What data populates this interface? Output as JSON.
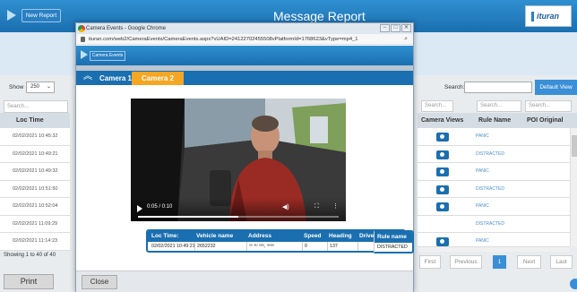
{
  "app": {
    "new_report_label": "New Report",
    "title": "Message Report",
    "logo_text": "ituran"
  },
  "table_controls": {
    "show_label": "Show",
    "show_value": "250",
    "search_label": "Search:",
    "default_view_label": "Default View",
    "column_search_placeholder": "Search..."
  },
  "left_table": {
    "header": "Loc Time",
    "rows": [
      "02/02/2021 10:45:32",
      "02/02/2021 10:49:21",
      "02/02/2021 10:49:32",
      "02/02/2021 10:51:50",
      "02/02/2021 10:52:04",
      "02/02/2021 11:09:29",
      "02/02/2021 11:14:23"
    ],
    "showing_text": "Showing 1 to 40 of 40"
  },
  "right_table": {
    "headers": [
      "Camera Views",
      "Rule Name",
      "POI Original"
    ],
    "rules": [
      "PANIC",
      "DISTRACTED",
      "PANIC",
      "DISTRACTED",
      "PANIC",
      "DISTRACTED",
      "PANIC"
    ],
    "camera_rows": [
      true,
      true,
      true,
      true,
      true,
      false,
      true
    ]
  },
  "pagination": {
    "first": "First",
    "previous": "Previous",
    "current": "1",
    "next": "Next",
    "last": "Last"
  },
  "print_label": "Print",
  "popup": {
    "window_title": "Camera Events - Google Chrome",
    "url": "ituran.com/web2/CameraEvents/CameraEvents.aspx?vUAID=24122702455508vPlatformId=1768623&vType=mp4_1",
    "camera_events_label": "Camera Events",
    "tabs": [
      "Camera 1",
      "Camera 2"
    ],
    "active_tab": "Camera 2",
    "video": {
      "current_time": "0:05 / 0:10",
      "progress": 0.5
    },
    "info_table": {
      "headers": [
        "Loc Time:",
        "Vehicle name",
        "Address",
        "Speed",
        "Heading",
        "Driver name",
        "Rule name"
      ],
      "row": [
        "02/02/2021 10:49:21",
        "2652232",
        "ᵘᵘ ᵃᵘ ᵘᵃᵘ, ᵃᵘᵃᵘ",
        "0",
        "137",
        "",
        "DISTRACTED"
      ]
    },
    "close_label": "Close"
  },
  "colors": {
    "header_blue": "#1a6fb0",
    "tab_active": "#f5a623",
    "rule_link": "#4a8fc9"
  }
}
